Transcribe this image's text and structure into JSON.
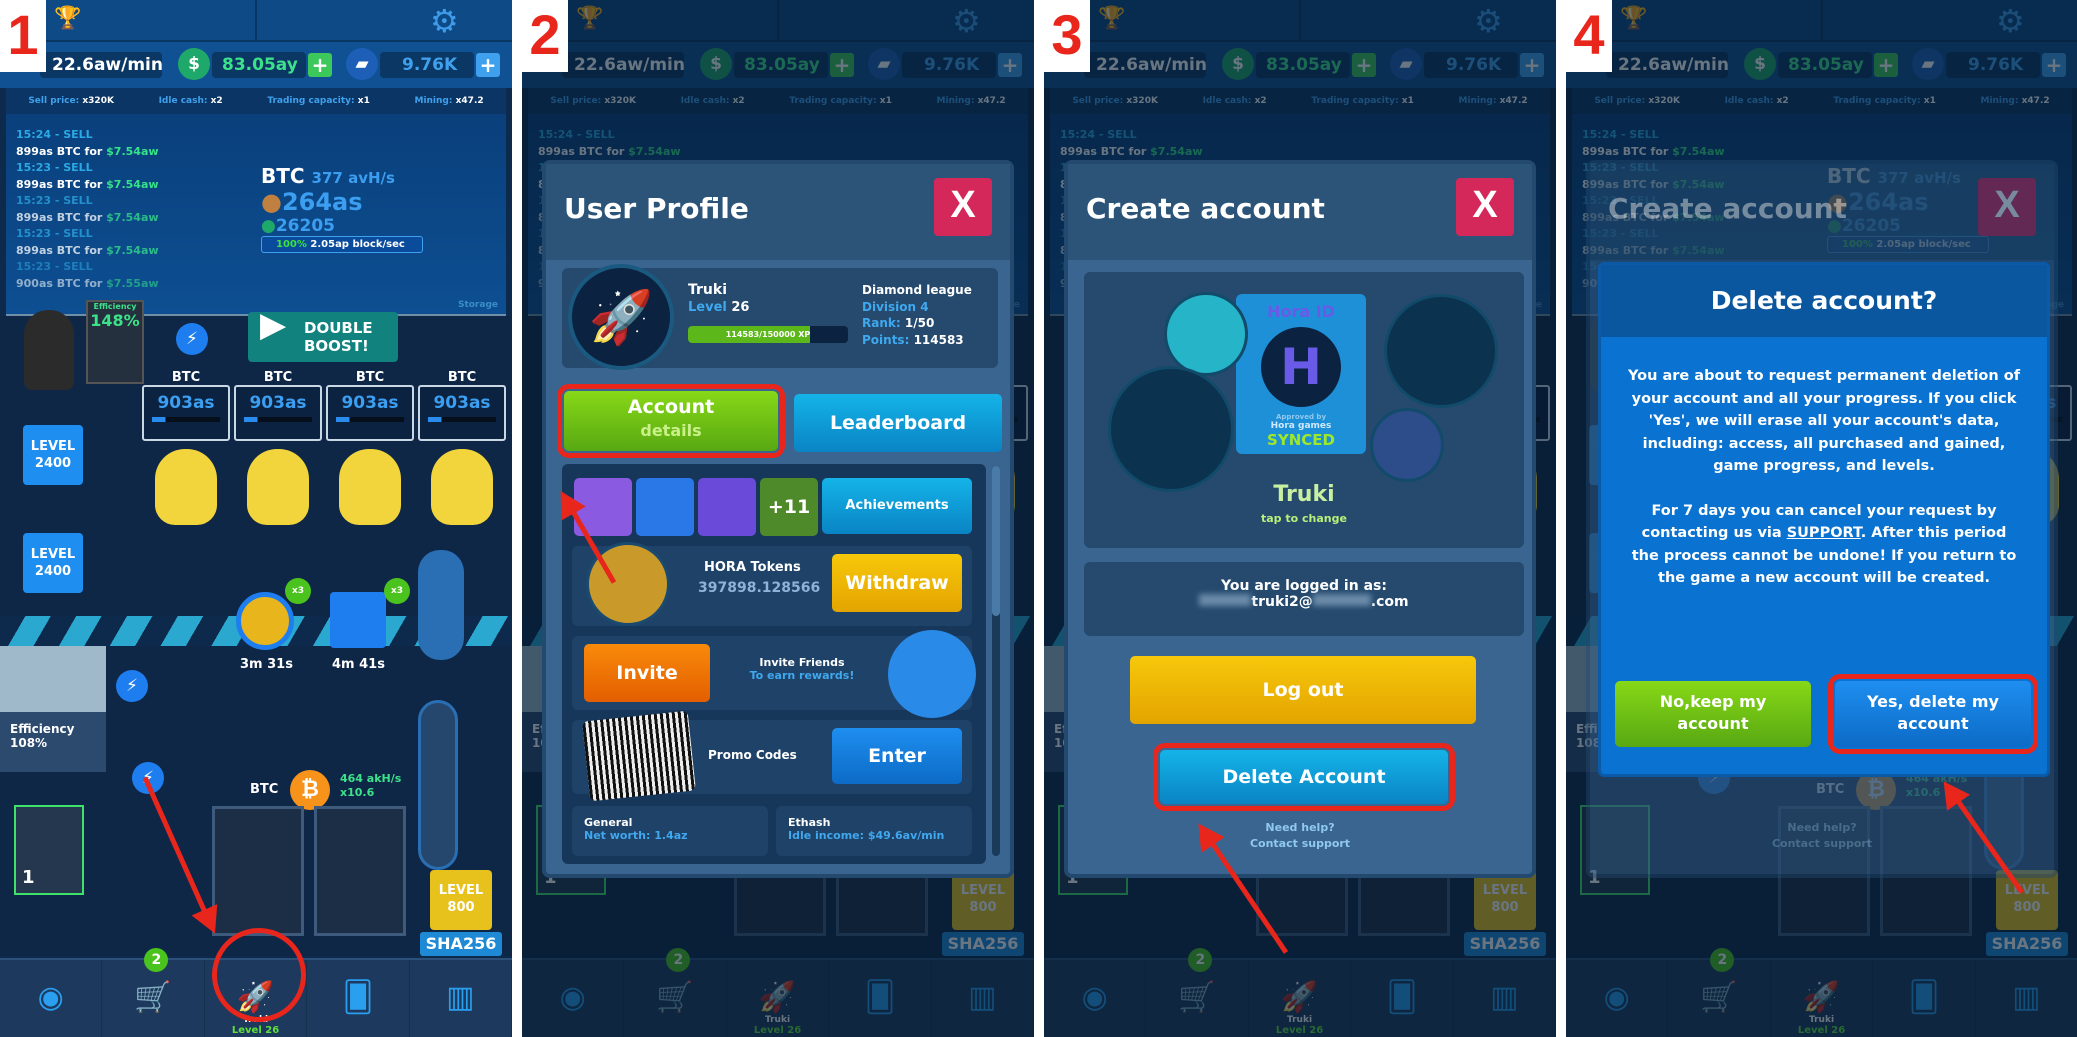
{
  "steps": [
    "1",
    "2",
    "3",
    "4"
  ],
  "header": {
    "rate": "22.6aw/min",
    "cash": "83.05ay",
    "gems": "9.76K",
    "plus": "+"
  },
  "stats": {
    "sell_label": "Sell price:",
    "sell": "x320K",
    "idle_label": "Idle cash:",
    "idle": "x2",
    "trading_label": "Trading capacity:",
    "trading": "x1",
    "mining_label": "Mining:",
    "mining": "x47.2"
  },
  "trades": [
    {
      "time": "15:24 - SELL",
      "desc": "899as BTC for ",
      "amount": "$7.54aw"
    },
    {
      "time": "15:23 - SELL",
      "desc": "899as BTC for ",
      "amount": "$7.54aw"
    },
    {
      "time": "15:23 - SELL",
      "desc": "899as BTC for ",
      "amount": "$7.54aw"
    },
    {
      "time": "15:23 - SELL",
      "desc": "899as BTC for ",
      "amount": "$7.54aw"
    },
    {
      "time": "15:23 - SELL",
      "desc": "900as BTC for ",
      "amount": "$7.55aw"
    }
  ],
  "btc": {
    "name": "BTC",
    "speed": "377 avH/s",
    "coins": "264as",
    "cash": "26205",
    "pct": "100%",
    "block": "2.05ap block/sec",
    "storage": "Storage"
  },
  "office": {
    "efficiency_label": "Efficiency",
    "efficiency": "148%",
    "double_boost": "DOUBLE BOOST!",
    "level1": "LEVEL 2400",
    "level2": "LEVEL 2400",
    "desks": [
      {
        "label": "BTC",
        "value": "903as"
      },
      {
        "label": "BTC",
        "value": "903as"
      },
      {
        "label": "BTC",
        "value": "903as"
      },
      {
        "label": "BTC",
        "value": "903as"
      }
    ],
    "timer1": "3m 31s",
    "timer2": "4m 41s",
    "multiplier": "x3"
  },
  "mining": {
    "efficiency": "Efficiency 108%",
    "gpu_count": "1",
    "coin": "BTC",
    "hashrate": "464 akH/s",
    "mult": "x10.6",
    "level": "LEVEL 800",
    "algo": "SHA256"
  },
  "nav": {
    "shop_badge": "2",
    "profile_name": "Truki",
    "profile_level": "Level 26"
  },
  "profile": {
    "title": "User Profile",
    "close": "X",
    "name": "Truki",
    "level_label": "Level",
    "level": "26",
    "xp": "114583/150000 XP",
    "xp_fraction": 0.764,
    "league": "Diamond league",
    "division": "Division 4",
    "rank_label": "Rank:",
    "rank": "1/50",
    "points_label": "Points:",
    "points": "114583",
    "account_button": "Account",
    "account_sub": "details",
    "leaderboard": "Leaderboard",
    "more_achievements": "+11",
    "achievements": "Achievements",
    "hora_label": "HORA Tokens",
    "hora_value": "397898.128566",
    "withdraw": "Withdraw",
    "invite": "Invite",
    "invite_title": "Invite Friends",
    "invite_sub": "To earn rewards!",
    "promo": "Promo Codes",
    "enter": "Enter",
    "general": "General",
    "net_worth": "Net worth: 1.4az",
    "ethash": "Ethash",
    "idle_income": "Idle income: $49.6av/min"
  },
  "account": {
    "title": "Create account",
    "close": "X",
    "hora_id": "Hora ID",
    "approved": "Approved by",
    "hora_games": "Hora games",
    "synced": "SYNCED",
    "name": "Truki",
    "tap": "tap to change",
    "logged_in": "You are logged in as:",
    "email": "truki2@",
    "email_end": ".com",
    "logout": "Log out",
    "delete": "Delete Account",
    "help": "Need help?",
    "contact": "Contact support"
  },
  "delete": {
    "title": "Delete account?",
    "p1": "You are about to request permanent deletion of your account and all your progress. If you click 'Yes', we will erase all your account's data, including: access, all purchased and gained, game progress, and levels.",
    "p2a": "For 7 days you can cancel your request by contacting us via ",
    "support": "SUPPORT",
    "p2b": ". After this period the process cannot be undone! If you return to the game a new account will be created.",
    "no": "No,keep my account",
    "yes": "Yes, delete my account"
  },
  "colors": {
    "highlight": "#e8261b",
    "green": "#58a813",
    "blue": "#0a84c4",
    "close": "#d4275a"
  }
}
